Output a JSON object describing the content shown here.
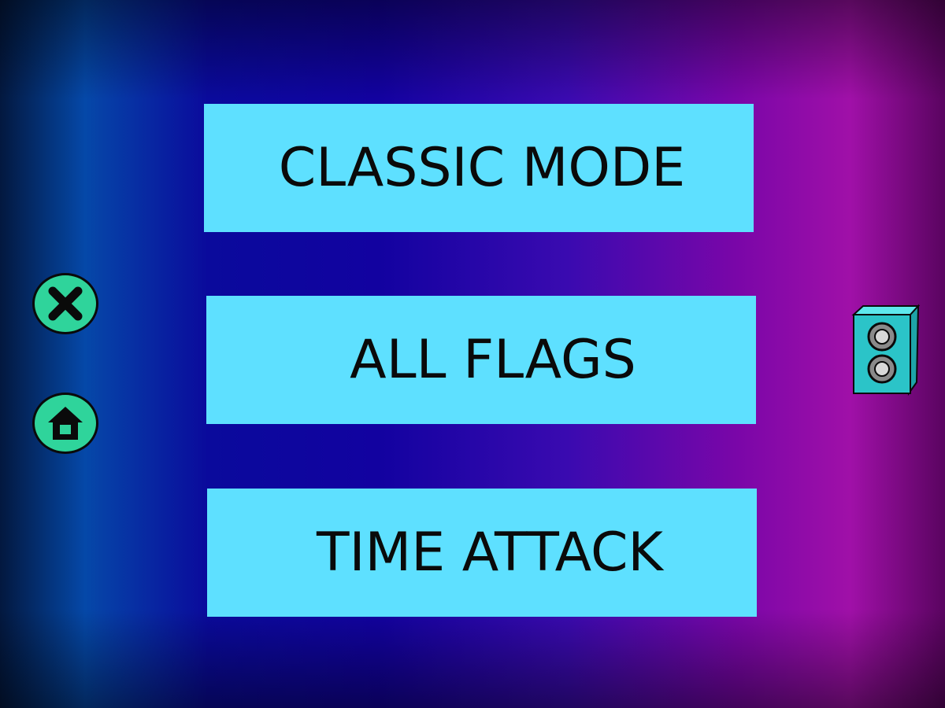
{
  "menu": {
    "buttons": [
      {
        "label": "CLASSIC MODE"
      },
      {
        "label": "ALL FLAGS"
      },
      {
        "label": "TIME ATTACK"
      }
    ]
  },
  "side_controls": {
    "close_icon": "close-icon",
    "home_icon": "home-icon",
    "sound_icon": "speaker-icon"
  },
  "colors": {
    "button_bg": "#5ee0ff",
    "round_button_bg": "#2fd49b",
    "speaker_body": "#2bc4c8"
  }
}
